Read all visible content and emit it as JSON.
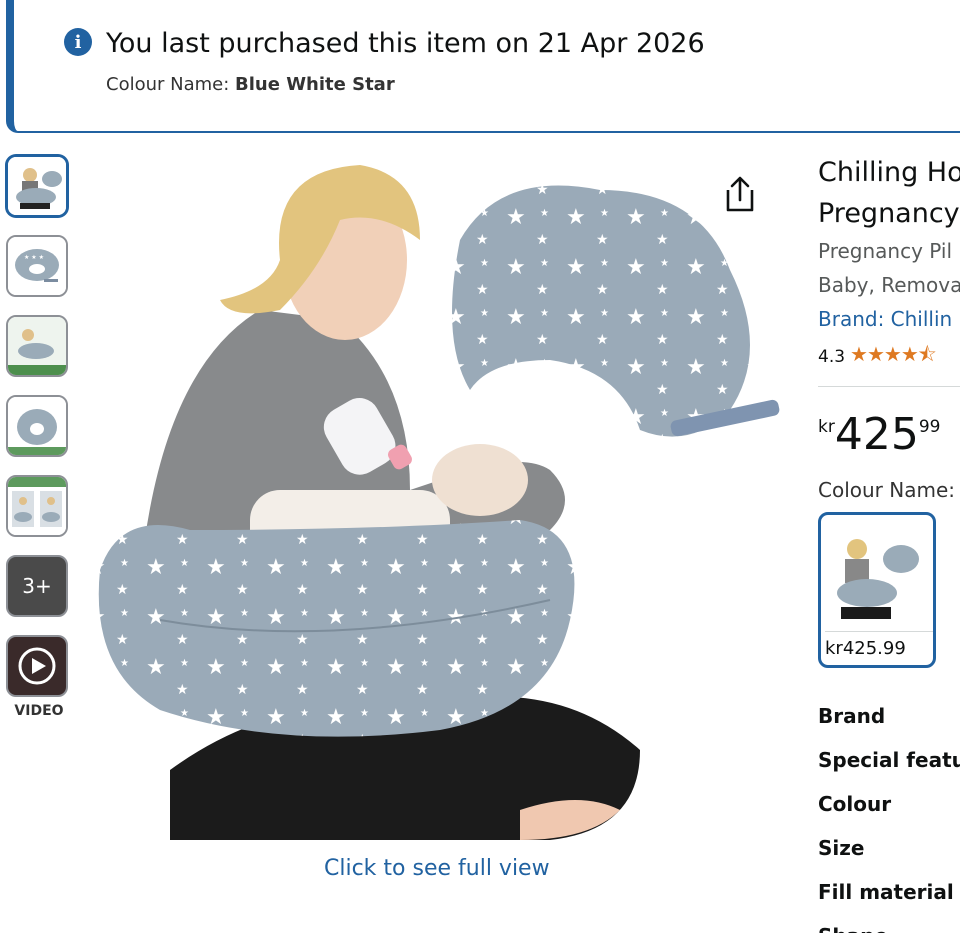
{
  "banner": {
    "icon": "info-icon",
    "title": "You last purchased this item on 21 Apr 2026",
    "colour_label": "Colour Name: ",
    "colour_value": "Blue White Star"
  },
  "gallery": {
    "more_label": "3+",
    "video_label": "VIDEO",
    "full_view_link": "Click to see full view"
  },
  "product": {
    "title_line1": "Chilling Ho",
    "title_line2": "Pregnancy",
    "subtitle_line1": "Pregnancy Pil",
    "subtitle_line2": "Baby, Remova",
    "brand_link": "Brand: Chillin",
    "rating": "4.3",
    "stars": "★★★★⯪",
    "price_currency": "kr",
    "price_whole": "425",
    "price_fraction": "99",
    "colour_label": "Colour Name:",
    "swatch_price": "kr425.99"
  },
  "specs": [
    "Brand",
    "Special featu",
    "Colour",
    "Size",
    "Fill material",
    "Shape"
  ],
  "colors": {
    "accent": "#2162a1",
    "star": "#de7921"
  }
}
